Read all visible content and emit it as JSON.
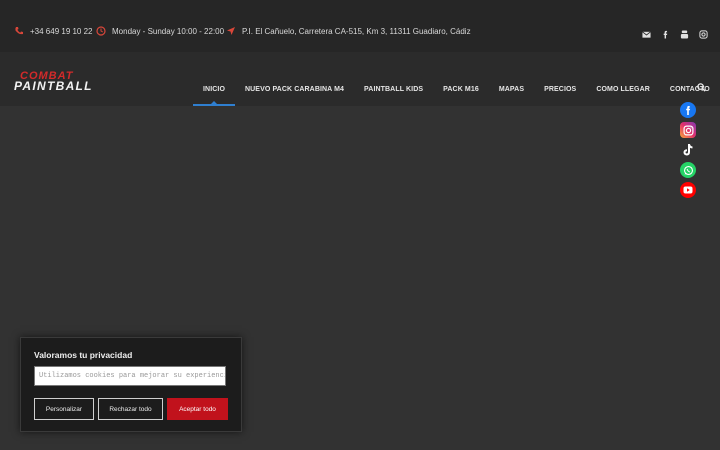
{
  "topbar": {
    "phone": "+34 649 19 10 22",
    "hours": "Monday - Sunday 10:00 - 22:00",
    "address": "P.I. El Cañuelo, Carretera CA-515, Km 3, 11311 Guadiaro, Cádiz",
    "social_icons": [
      "envelope-icon",
      "facebook-icon",
      "youtube-icon",
      "instagram-icon"
    ]
  },
  "header": {
    "logo_text_top": "COMBAT",
    "logo_text_bottom": "PAINTBALL",
    "nav": [
      {
        "label": "INICIO",
        "active": true
      },
      {
        "label": "NUEVO PACK CARABINA M4"
      },
      {
        "label": "PAINTBALL KIDS"
      },
      {
        "label": "PACK M16"
      },
      {
        "label": "MAPAS"
      },
      {
        "label": "PRECIOS"
      },
      {
        "label": "COMO LLEGAR"
      },
      {
        "label": "CONTACTO"
      }
    ]
  },
  "floating_social": [
    "facebook-icon",
    "instagram-icon",
    "tiktok-icon",
    "whatsapp-icon",
    "youtube-icon"
  ],
  "cookie": {
    "title": "Valoramos tu privacidad",
    "input_placeholder": "Utilizamos cookies para mejorar su experiencia",
    "customize": "Personalizar",
    "reject": "Rechazar todo",
    "accept": "Aceptar todo"
  },
  "colors": {
    "accent_red": "#c1121c",
    "active_blue": "#2f7fd0",
    "topbar_bg": "#262626",
    "header_bg": "#2b2b2b",
    "page_bg": "#323232"
  }
}
